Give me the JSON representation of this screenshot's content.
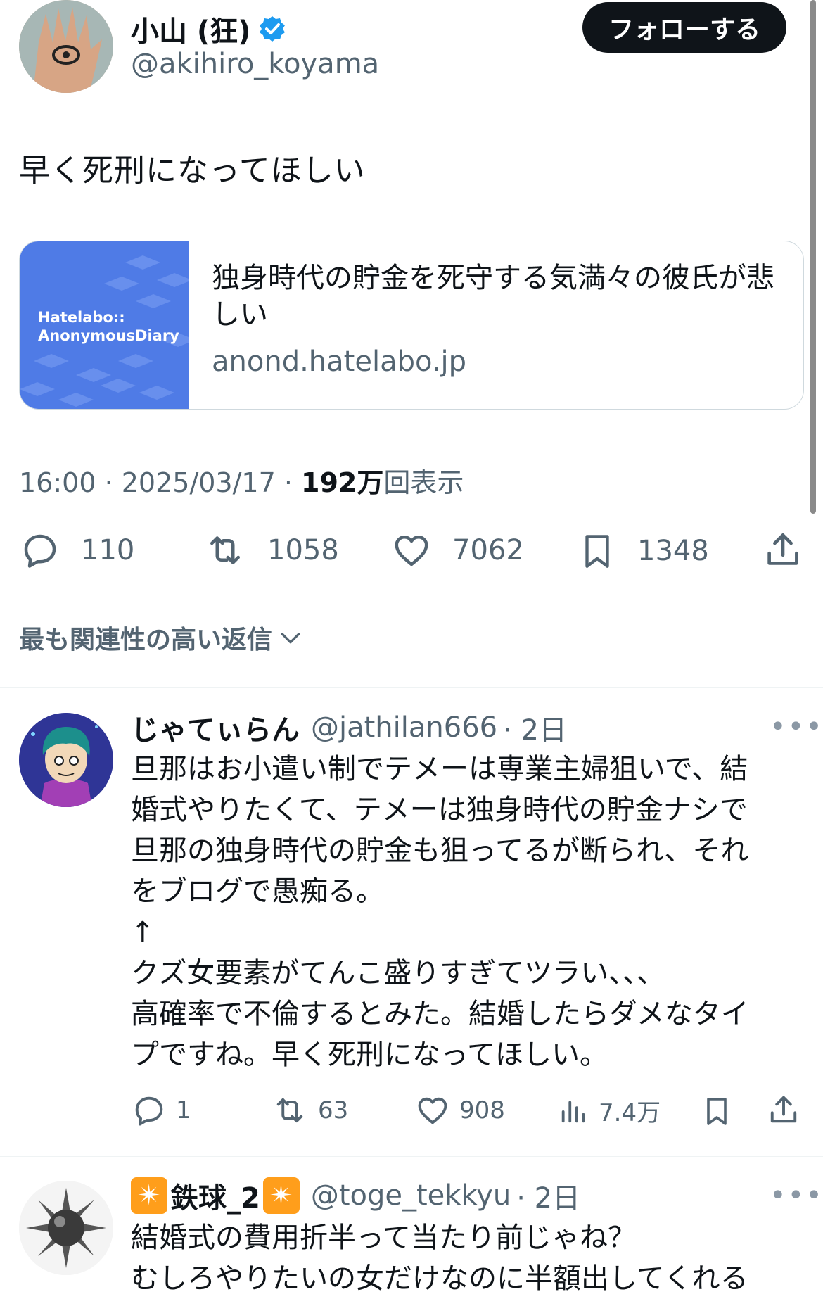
{
  "tweet": {
    "author": {
      "name": "小山 (狂)",
      "handle": "@akihiro_koyama"
    },
    "follow_label": "フォローする",
    "text": "早く死刑になってほしい",
    "card": {
      "image_line1": "Hatelabo::",
      "image_line2": "AnonymousDiary",
      "title": "独身時代の貯金を死守する気満々の彼氏が悲しい",
      "domain": "anond.hatelabo.jp"
    },
    "meta": {
      "time_date": "16:00 · 2025/03/17 · ",
      "views_num": "192万",
      "views_label": "回表示"
    },
    "stats": {
      "replies": "110",
      "retweets": "1058",
      "likes": "7062",
      "bookmarks": "1348"
    }
  },
  "sort_label": "最も関連性の高い返信",
  "replies": [
    {
      "name": "じゃてぃらん",
      "handle": "@jathilan666",
      "age": "· 2日",
      "more": "•••",
      "lines": [
        "旦那はお小遣い制でテメーは専業主婦狙いで、結",
        "婚式やりたくて、テメーは独身時代の貯金ナシで",
        "旦那の独身時代の貯金も狙ってるが断られ、それ",
        "をブログで愚痴る。",
        "↑",
        "クズ女要素がてんこ盛りすぎてツラい、、、",
        "高確率で不倫するとみた。結婚したらダメなタイ",
        "プですね。早く死刑になってほしい。"
      ],
      "stats": {
        "replies": "1",
        "retweets": "63",
        "likes": "908",
        "views": "7.4万"
      }
    },
    {
      "name": "鉄球_2",
      "handle": "@toge_tekkyu",
      "age": "· 2日",
      "more": "•••",
      "lines": [
        "結婚式の費用折半って当たり前じゃね？",
        "むしろやりたいの女だけなのに半額出してくれる"
      ]
    }
  ],
  "colors": {
    "accent": "#1d9bf0",
    "text": "#0f1419",
    "secondary": "#536471",
    "card_bg": "#4f7be6"
  }
}
